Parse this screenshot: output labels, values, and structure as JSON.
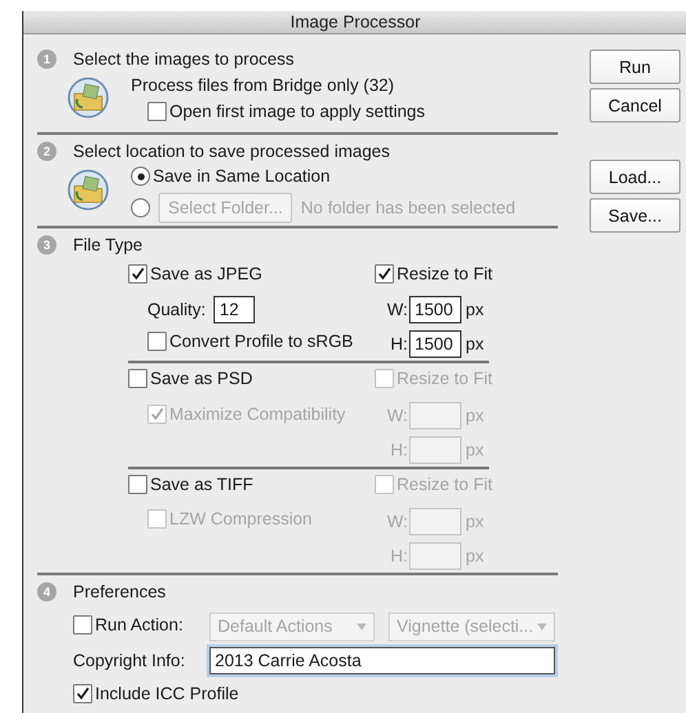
{
  "window": {
    "title": "Image Processor"
  },
  "source": {
    "number": "1",
    "title": "Select the images to process",
    "info": "Process files from Bridge only (32)",
    "open_first": {
      "label": "Open first image to apply settings",
      "checked": false
    }
  },
  "destination": {
    "number": "2",
    "title": "Select location to save processed images",
    "options": [
      {
        "label": "Save in Same Location",
        "selected": true
      },
      {
        "button": "Select Folder...",
        "note": "No folder has been selected",
        "selected": false
      }
    ]
  },
  "file_type": {
    "number": "3",
    "title": "File Type",
    "formats": [
      {
        "label": "Save as JPEG",
        "checked": true,
        "options": [
          {
            "kind": "field",
            "label": "Quality:",
            "value": "12"
          },
          {
            "kind": "checkbox",
            "label": "Convert Profile to sRGB",
            "checked": false,
            "disabled": false
          }
        ],
        "resize": {
          "label": "Resize to Fit",
          "checked": true,
          "disabled": false,
          "width": {
            "label": "W:",
            "value": "1500",
            "unit": "px"
          },
          "height": {
            "label": "H:",
            "value": "1500",
            "unit": "px"
          }
        }
      },
      {
        "label": "Save as PSD",
        "checked": false,
        "options": [
          {
            "kind": "checkbox",
            "label": "Maximize Compatibility",
            "checked": true,
            "disabled": true
          }
        ],
        "resize": {
          "label": "Resize to Fit",
          "checked": false,
          "disabled": true,
          "width": {
            "label": "W:",
            "unit": "px"
          },
          "height": {
            "label": "H:",
            "unit": "px"
          }
        }
      },
      {
        "label": "Save as TIFF",
        "checked": false,
        "options": [
          {
            "kind": "checkbox",
            "label": "LZW Compression",
            "checked": false,
            "disabled": true
          }
        ],
        "resize": {
          "label": "Resize to Fit",
          "checked": false,
          "disabled": true,
          "width": {
            "label": "W:",
            "unit": "px"
          },
          "height": {
            "label": "H:",
            "unit": "px"
          }
        }
      }
    ]
  },
  "preferences": {
    "number": "4",
    "title": "Preferences",
    "run_action": {
      "label": "Run Action:",
      "checked": false,
      "disabled": true,
      "action_set": "Default Actions",
      "action": "Vignette (selecti..."
    },
    "copyright": {
      "label": "Copyright Info:",
      "value": "2013 Carrie Acosta"
    },
    "include_icc": {
      "label": "Include ICC Profile",
      "checked": true
    }
  },
  "primary_buttons": [
    "Run",
    "Cancel"
  ],
  "settings_buttons": [
    "Load...",
    "Save..."
  ]
}
